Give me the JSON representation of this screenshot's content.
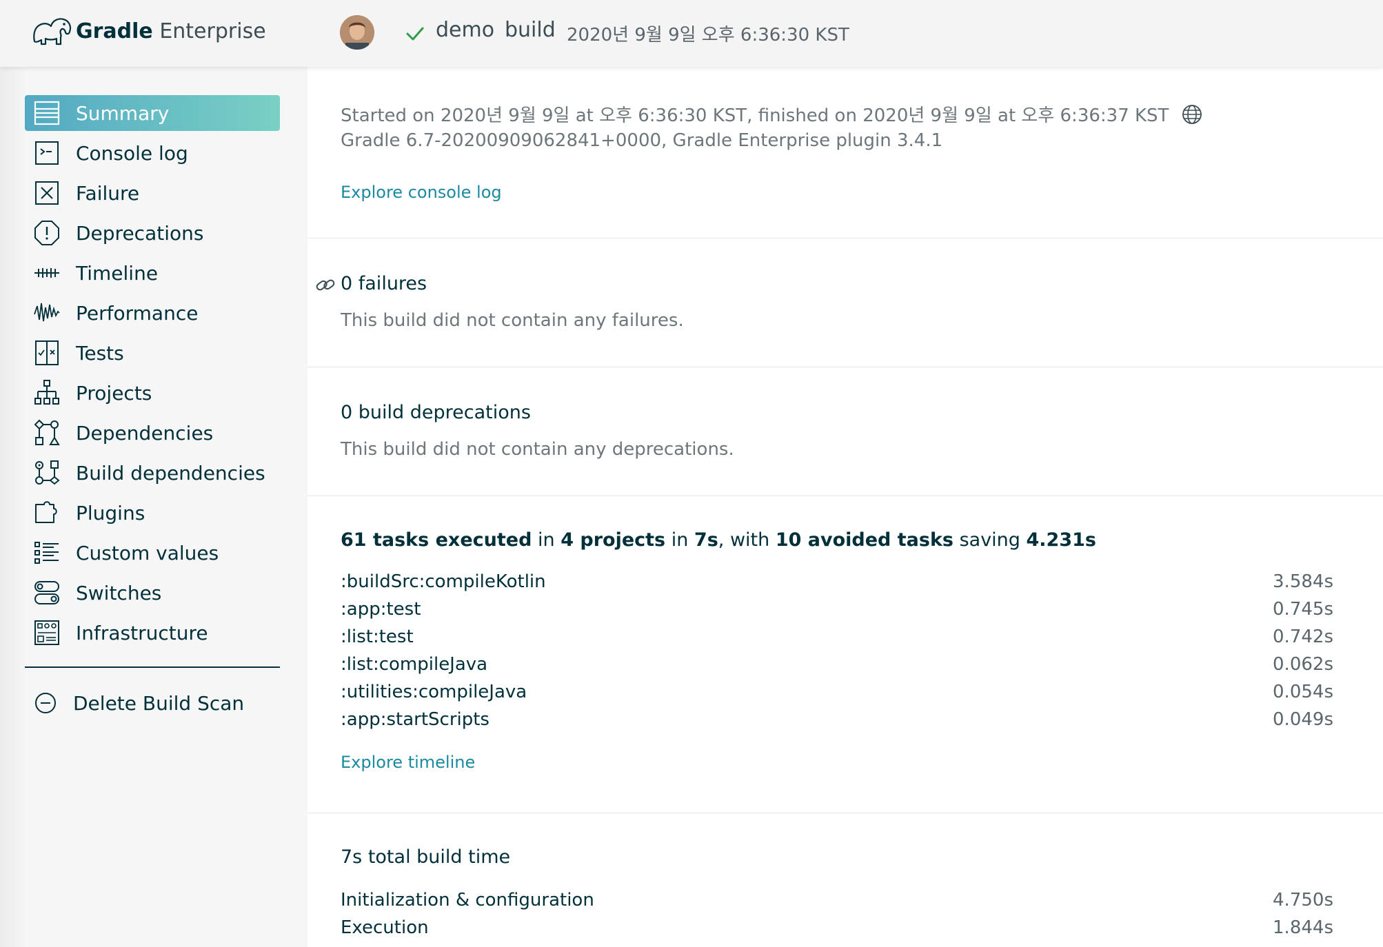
{
  "header": {
    "brand": "Gradle",
    "product": "Enterprise",
    "project": "demo",
    "task": "build",
    "timestamp": "2020년 9월 9일 오후 6:36:30 KST"
  },
  "sidebar": {
    "items": [
      {
        "label": "Summary",
        "icon": "summary-icon",
        "active": true
      },
      {
        "label": "Console log",
        "icon": "console-icon"
      },
      {
        "label": "Failure",
        "icon": "failure-icon"
      },
      {
        "label": "Deprecations",
        "icon": "deprecations-icon"
      },
      {
        "label": "Timeline",
        "icon": "timeline-icon"
      },
      {
        "label": "Performance",
        "icon": "performance-icon"
      },
      {
        "label": "Tests",
        "icon": "tests-icon"
      },
      {
        "label": "Projects",
        "icon": "projects-icon"
      },
      {
        "label": "Dependencies",
        "icon": "dependencies-icon"
      },
      {
        "label": "Build dependencies",
        "icon": "build-dependencies-icon"
      },
      {
        "label": "Plugins",
        "icon": "plugins-icon"
      },
      {
        "label": "Custom values",
        "icon": "custom-values-icon"
      },
      {
        "label": "Switches",
        "icon": "switches-icon"
      },
      {
        "label": "Infrastructure",
        "icon": "infrastructure-icon"
      }
    ],
    "delete_label": "Delete Build Scan"
  },
  "summary": {
    "started_text": "Started on 2020년 9월 9일 at 오후 6:36:30 KST, finished on 2020년 9월 9일 at 오후 6:36:37 KST",
    "versions_text": "Gradle 6.7-20200909062841+0000,  Gradle Enterprise plugin 3.4.1",
    "console_link": "Explore console log"
  },
  "failures": {
    "title": "0 failures",
    "message": "This build did not contain any failures."
  },
  "deprecations": {
    "title": "0 build deprecations",
    "message": "This build did not contain any deprecations."
  },
  "tasks": {
    "executed": "61 tasks executed",
    "in1": " in ",
    "projects": "4 projects",
    "in2": " in ",
    "duration": "7s",
    "with": ", with ",
    "avoided": "10 avoided tasks",
    "saving": " saving ",
    "saved": "4.231s",
    "rows": [
      {
        "name": ":buildSrc:compileKotlin",
        "time": "3.584s"
      },
      {
        "name": ":app:test",
        "time": "0.745s"
      },
      {
        "name": ":list:test",
        "time": "0.742s"
      },
      {
        "name": ":list:compileJava",
        "time": "0.062s"
      },
      {
        "name": ":utilities:compileJava",
        "time": "0.054s"
      },
      {
        "name": ":app:startScripts",
        "time": "0.049s"
      }
    ],
    "timeline_link": "Explore timeline"
  },
  "build_time": {
    "title": "7s total build time",
    "rows": [
      {
        "name": "Initialization & configuration",
        "time": "4.750s"
      },
      {
        "name": "Execution",
        "time": "1.844s"
      }
    ]
  },
  "colors": {
    "accent_start": "#53a9c2",
    "accent_end": "#79d0c4",
    "text": "#02303a",
    "link": "#1a8aa1",
    "success": "#2e9c4c"
  }
}
